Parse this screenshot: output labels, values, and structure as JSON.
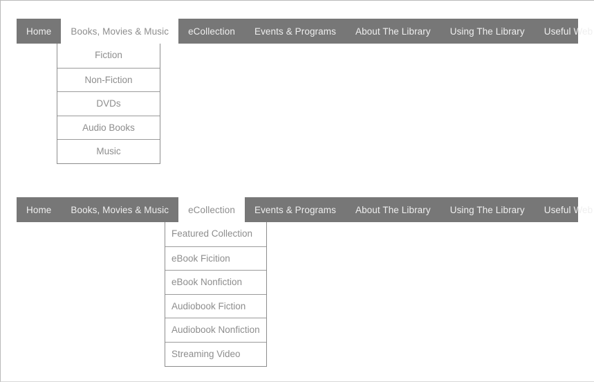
{
  "page": {
    "background_color": "#ffffff",
    "frame_border_color": "#b9b9b9"
  },
  "colors": {
    "navbar_background": "#777777",
    "navbar_text": "#efefef",
    "active_tab_background": "#ffffff",
    "active_tab_text": "#8d8d8d",
    "dropdown_background": "#ffffff",
    "dropdown_text": "#8d8d8d",
    "dropdown_border": "#8c8c8c"
  },
  "menus": [
    {
      "id": "menu-books-movies-music",
      "active_tab": "Books, Movies & Music",
      "tabs": [
        {
          "label": "Home",
          "active": false
        },
        {
          "label": "Books, Movies & Music",
          "active": true
        },
        {
          "label": "eCollection",
          "active": false
        },
        {
          "label": "Events & Programs",
          "active": false
        },
        {
          "label": "About The Library",
          "active": false
        },
        {
          "label": "Using The Library",
          "active": false
        },
        {
          "label": "Useful Web Resources",
          "active": false
        }
      ],
      "dropdown": {
        "align": "center",
        "items": [
          {
            "label": "Fiction"
          },
          {
            "label": "Non-Fiction"
          },
          {
            "label": "DVDs"
          },
          {
            "label": "Audio Books"
          },
          {
            "label": "Music"
          }
        ]
      }
    },
    {
      "id": "menu-ecollection",
      "active_tab": "eCollection",
      "tabs": [
        {
          "label": "Home",
          "active": false
        },
        {
          "label": "Books, Movies & Music",
          "active": false
        },
        {
          "label": "eCollection",
          "active": true
        },
        {
          "label": "Events & Programs",
          "active": false
        },
        {
          "label": "About The Library",
          "active": false
        },
        {
          "label": "Using The Library",
          "active": false
        },
        {
          "label": "Useful Web Resources",
          "active": false
        }
      ],
      "dropdown": {
        "align": "left",
        "items": [
          {
            "label": "Featured Collection"
          },
          {
            "label": "eBook Ficition"
          },
          {
            "label": "eBook Nonfiction"
          },
          {
            "label": "Audiobook Fiction"
          },
          {
            "label": "Audiobook Nonfiction"
          },
          {
            "label": "Streaming Video"
          }
        ]
      }
    }
  ]
}
